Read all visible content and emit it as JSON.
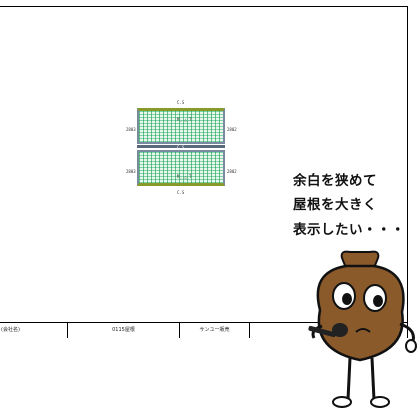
{
  "drawing": {
    "top_label": "C.S",
    "bottom_label": "C.S",
    "ridge_label": "C.S",
    "left_top": "2803",
    "left_bottom": "2803",
    "right_top": "2802",
    "right_bottom": "2802",
    "upper_tag": "M_ △ T",
    "lower_tag": "M_ △ T"
  },
  "footer": {
    "company": "(会社名)",
    "drawing_name": "0115屋根",
    "maker": "サンユー販売",
    "extra": ""
  },
  "callout": {
    "line1": "余白を狭めて",
    "line2": "屋根を大きく",
    "line3": "表示したい・・・"
  },
  "colors": {
    "roof_fill": "#e9f7ee",
    "roof_lines": "#009a3c",
    "frame": "#7a8aa0",
    "eave": "#8a9a2a",
    "character_body": "#8a5a2b"
  },
  "icons": [
    "mascot-character",
    "microphone-icon"
  ]
}
